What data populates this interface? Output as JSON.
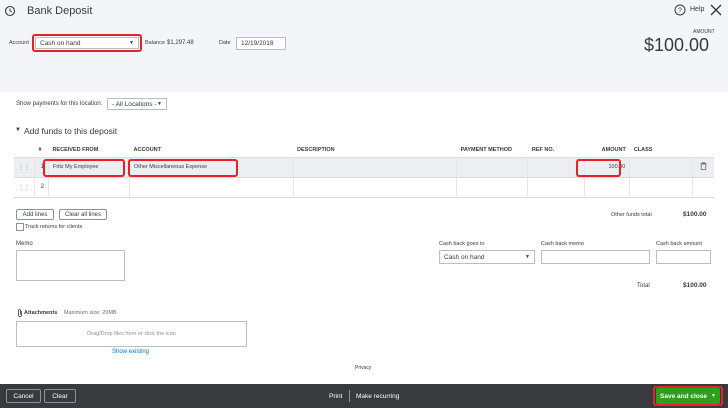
{
  "header": {
    "title": "Bank Deposit",
    "help_label": "Help",
    "account_label": "Account",
    "account_value": "Cash on hand",
    "balance_label": "Balance",
    "balance_value": "$1,297.48",
    "date_label": "Date",
    "date_value": "12/19/2018",
    "amount_label": "AMOUNT",
    "amount_value": "$100.00"
  },
  "filter": {
    "label": "Show payments for this location:",
    "value": "- All Locations -"
  },
  "section": {
    "title": "Add funds to this deposit"
  },
  "table": {
    "columns": [
      "#",
      "RECEIVED FROM",
      "ACCOUNT",
      "DESCRIPTION",
      "PAYMENT METHOD",
      "REF NO.",
      "AMOUNT",
      "CLASS"
    ],
    "rows": [
      {
        "num": "1",
        "received_from": "Fritz My Employee",
        "account": "Other Miscellaneous Expense",
        "description": "",
        "payment_method": "",
        "ref_no": "",
        "amount": "100.00",
        "class": ""
      },
      {
        "num": "2",
        "received_from": "",
        "account": "",
        "description": "",
        "payment_method": "",
        "ref_no": "",
        "amount": "",
        "class": ""
      }
    ]
  },
  "actions": {
    "add_lines": "Add lines",
    "clear_all_lines": "Clear all lines",
    "track_returns": "Track returns for clients",
    "other_funds_label": "Other funds total",
    "other_funds_value": "$100.00"
  },
  "memo": {
    "label": "Memo"
  },
  "cashback": {
    "goes_to_label": "Cash back goes to",
    "goes_to_value": "Cash on hand",
    "memo_label": "Cash back memo",
    "amount_label": "Cash back amount",
    "total_label": "Total",
    "total_value": "$100.00"
  },
  "attachments": {
    "label": "Attachments",
    "max_size": "Maximum size: 20MB",
    "drop_text": "Drag/Drop files here or click the icon",
    "show_existing": "Show existing"
  },
  "privacy": "Privacy",
  "footer": {
    "cancel": "Cancel",
    "clear": "Clear",
    "print": "Print",
    "make_recurring": "Make recurring",
    "save_and_close": "Save and close"
  }
}
